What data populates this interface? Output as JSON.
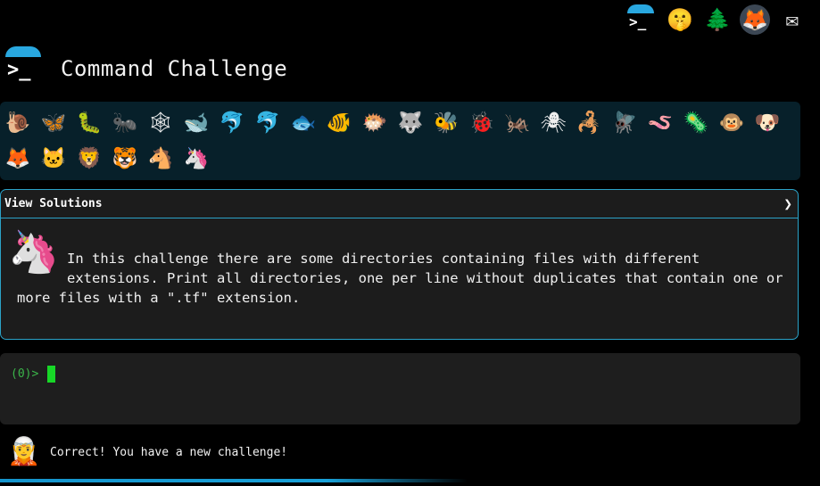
{
  "topbar": {
    "icons": [
      {
        "name": "terminal-logo-icon",
        "glyph": ">_"
      },
      {
        "name": "shushing-face-icon",
        "glyph": "🤫"
      },
      {
        "name": "evergreen-tree-icon",
        "glyph": "🌲"
      },
      {
        "name": "gitlab-icon",
        "glyph": "🦊"
      },
      {
        "name": "envelope-icon",
        "glyph": "✉"
      }
    ]
  },
  "header": {
    "logo_prompt": ">_",
    "title": "Command Challenge"
  },
  "animals": {
    "row1": [
      "🐌",
      "🦋",
      "🐛",
      "🐜",
      "🕸",
      "🐋",
      "🐬",
      "🐬",
      "🐟",
      "🐠",
      "🐡",
      "🐺",
      "🐝",
      "🐞",
      "🦗",
      "🕷",
      "🦂",
      "🪰",
      "🪱",
      "🦠",
      "🐵",
      "🐶"
    ],
    "row2": [
      "🦊",
      "🐱",
      "🦁",
      "🐯",
      "🐴",
      "🦄"
    ]
  },
  "challenge": {
    "header_label": "View Solutions",
    "chevron": "❯",
    "avatar_glyph": "🦄",
    "description": "In this challenge there are some directories containing files with different extensions. Print all directories, one per line without duplicates that contain one or more files with a \".tf\" extension."
  },
  "terminal": {
    "prompt": "(0)>"
  },
  "status": {
    "avatar_glyph": "🧝",
    "message": "Correct! You have a new challenge!"
  },
  "progress": {
    "fraction": 0.57,
    "color": "#19a1d8"
  },
  "colors": {
    "accent": "#2ba2c8",
    "prompt_green": "#3bb64a",
    "cursor_green": "#17d727",
    "animal_bar_bg": "#07202a"
  }
}
